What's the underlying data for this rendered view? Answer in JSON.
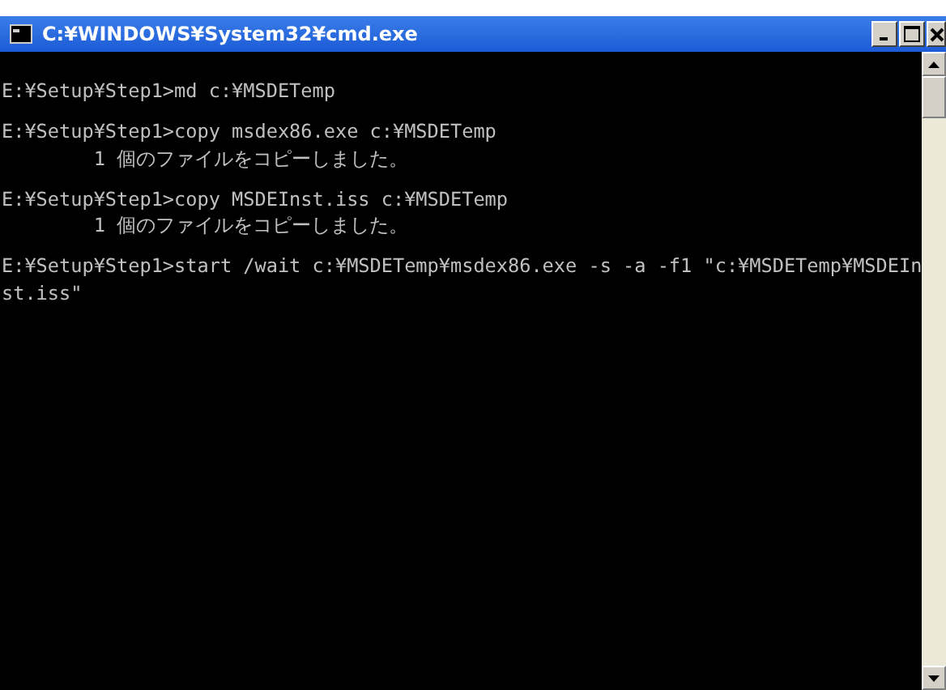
{
  "window": {
    "title": "C:¥WINDOWS¥System32¥cmd.exe"
  },
  "console": {
    "blocks": [
      {
        "lines": [
          "E:¥Setup¥Step1>md c:¥MSDETemp"
        ]
      },
      {
        "lines": [
          "E:¥Setup¥Step1>copy msdex86.exe c:¥MSDETemp",
          "        1 個のファイルをコピーしました。"
        ]
      },
      {
        "lines": [
          "E:¥Setup¥Step1>copy MSDEInst.iss c:¥MSDETemp",
          "        1 個のファイルをコピーしました。"
        ]
      },
      {
        "lines": [
          "E:¥Setup¥Step1>start /wait c:¥MSDETemp¥msdex86.exe -s -a -f1 \"c:¥MSDETemp¥MSDEIn",
          "st.iss\""
        ]
      }
    ]
  }
}
